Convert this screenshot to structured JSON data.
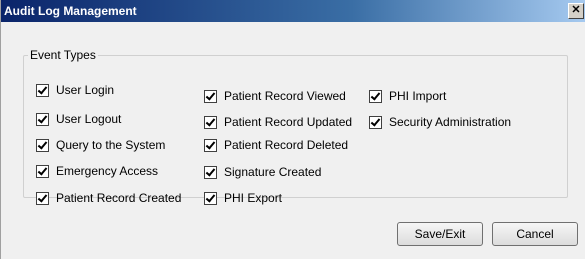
{
  "window": {
    "title": "Audit Log Management",
    "close_glyph": "✕"
  },
  "group": {
    "legend": "Event Types"
  },
  "checkboxes": [
    {
      "label": "User Login",
      "checked": true
    },
    {
      "label": "User Logout",
      "checked": true
    },
    {
      "label": "Query to the System",
      "checked": true
    },
    {
      "label": "Emergency Access",
      "checked": true
    },
    {
      "label": "Patient Record Created",
      "checked": true
    },
    {
      "label": "Patient Record Viewed",
      "checked": true
    },
    {
      "label": "Patient Record Updated",
      "checked": true
    },
    {
      "label": "Patient Record Deleted",
      "checked": true
    },
    {
      "label": "Signature Created",
      "checked": true
    },
    {
      "label": "PHI Export",
      "checked": true
    },
    {
      "label": "PHI Import",
      "checked": true
    },
    {
      "label": "Security Administration",
      "checked": true
    }
  ],
  "buttons": {
    "save_label": "Save/Exit",
    "cancel_label": "Cancel"
  }
}
